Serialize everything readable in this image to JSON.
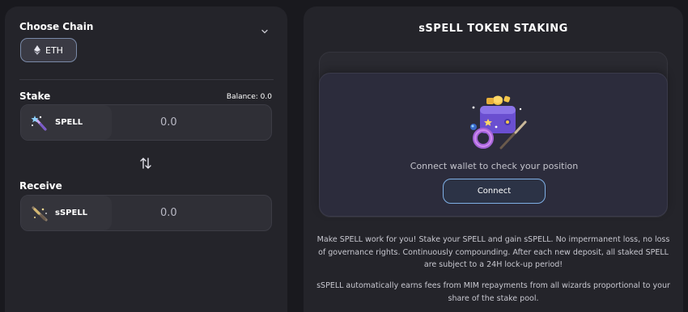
{
  "left": {
    "choose_chain_label": "Choose Chain",
    "chain_button_label": "ETH",
    "stake_label": "Stake",
    "balance_text": "Balance: 0.0",
    "stake_token": {
      "symbol": "SPELL",
      "amount": "0.0"
    },
    "receive_label": "Receive",
    "receive_token": {
      "symbol": "sSPELL",
      "amount": "0.0"
    }
  },
  "right": {
    "title": "sSPELL TOKEN STAKING",
    "connect_message": "Connect wallet to check your position",
    "connect_button_label": "Connect",
    "description_1": "Make SPELL work for you! Stake your SPELL and gain sSPELL. No impermanent loss, no loss of governance rights. Continuously compounding. After each new deposit, all staked SPELL are subject to a 24H lock-up period!",
    "description_2": "sSPELL automatically earns fees from MIM repayments from all wizards proportional to your share of the stake pool."
  },
  "icons": {
    "chevron": "chevron-down-icon",
    "eth": "ethereum-icon",
    "spell": "spell-wand-icon",
    "sspell": "sspell-wand-icon",
    "swap": "swap-arrows-icon",
    "wallet": "wallet-illustration"
  },
  "colors": {
    "background": "#19191e",
    "panel": "#24242a",
    "accent_blue": "#7fb0e6",
    "connect_card": "#2c2c3c"
  }
}
